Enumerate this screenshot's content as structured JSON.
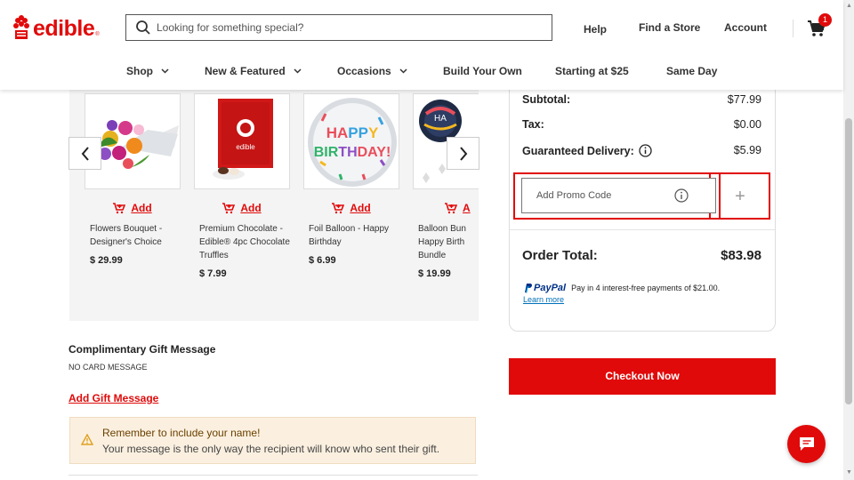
{
  "brand": {
    "name": "edible",
    "tm": "®",
    "color": "#e10a0a"
  },
  "search": {
    "placeholder": "Looking for something special?"
  },
  "topnav": {
    "help": "Help",
    "find_store": "Find a Store",
    "account": "Account",
    "cart_count": "1"
  },
  "catnav": [
    {
      "label": "Shop",
      "has_chevron": true
    },
    {
      "label": "New & Featured",
      "has_chevron": true
    },
    {
      "label": "Occasions",
      "has_chevron": true
    },
    {
      "label": "Build Your Own",
      "has_chevron": false
    },
    {
      "label": "Starting at $25",
      "has_chevron": false
    },
    {
      "label": "Same Day",
      "has_chevron": false
    }
  ],
  "products": [
    {
      "name": "Flowers Bouquet - Designer's Choice",
      "price": "$ 29.99",
      "add_label": "Add",
      "image": "flower-bouquet"
    },
    {
      "name": "Premium Chocolate - Edible® 4pc Chocolate Truffles",
      "price": "$ 7.99",
      "add_label": "Add",
      "image": "chocolate-box"
    },
    {
      "name": "Foil Balloon - Happy Birthday",
      "price": "$ 6.99",
      "add_label": "Add",
      "image": "birthday-balloon"
    },
    {
      "name": "Balloon Bundle - Happy Birthday Bundle",
      "name_visible": "Balloon Bun\nHappy Birth\nBundle",
      "price": "$ 19.99",
      "add_label": "A",
      "image": "balloon-bundle"
    }
  ],
  "gift": {
    "title": "Complimentary Gift Message",
    "current": "NO CARD MESSAGE",
    "add_link": "Add Gift Message",
    "notice_title": "Remember to include your name!",
    "notice_text": "Your message is the only way the recipient will know who sent their gift."
  },
  "summary": {
    "subtotal_label": "Subtotal:",
    "subtotal": "$77.99",
    "tax_label": "Tax:",
    "tax": "$0.00",
    "delivery_label": "Guaranteed Delivery:",
    "delivery": "$5.99",
    "promo_placeholder": "Add Promo Code",
    "promo_add": "+",
    "total_label": "Order Total:",
    "total": "$83.98",
    "paypal_brand": "PayPal",
    "paypal_text": "Pay in 4 interest-free payments of $21.00.",
    "paypal_link": "Learn more",
    "checkout": "Checkout Now"
  }
}
